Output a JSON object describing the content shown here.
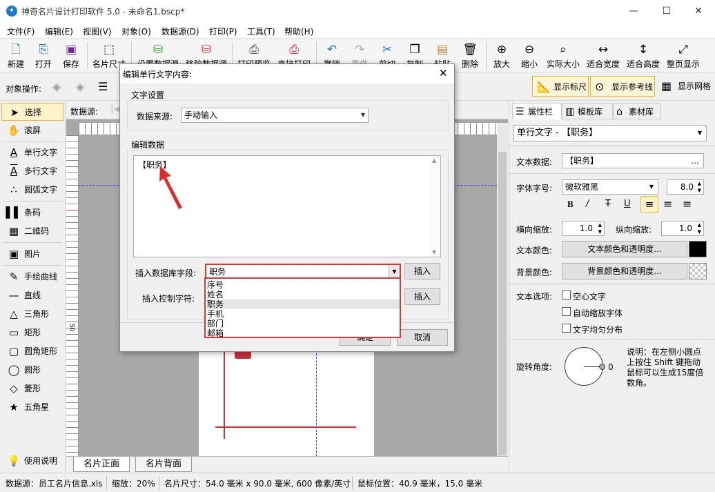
{
  "window": {
    "title": "神奇名片设计打印软件 5.0 - 未命名1.bscp*",
    "app_icon": "app-logo-icon"
  },
  "menu": [
    "文件(F)",
    "编辑(E)",
    "视图(V)",
    "对象(O)",
    "数据源(D)",
    "打印(P)",
    "工具(T)",
    "帮助(H)"
  ],
  "toolbar": [
    {
      "label": "新建",
      "icon": "new-file-icon",
      "glyph": "🗋"
    },
    {
      "label": "打开",
      "icon": "open-icon",
      "glyph": "📂"
    },
    {
      "label": "保存",
      "icon": "save-icon",
      "glyph": "💾"
    },
    {
      "label": "名片尺寸",
      "icon": "card-size-icon",
      "glyph": "⬚"
    },
    {
      "label": "设置数据源",
      "icon": "database-settings-icon",
      "glyph": "⛁"
    },
    {
      "label": "移除数据源",
      "icon": "database-remove-icon",
      "glyph": "⛁"
    },
    {
      "label": "打印预览",
      "icon": "print-preview-icon",
      "glyph": "🖶"
    },
    {
      "label": "直接打印",
      "icon": "print-icon",
      "glyph": "🖶"
    },
    {
      "label": "撤销",
      "icon": "undo-icon",
      "glyph": "↶"
    },
    {
      "label": "重做",
      "icon": "redo-icon",
      "glyph": "↷"
    },
    {
      "label": "剪切",
      "icon": "cut-icon",
      "glyph": "✂"
    },
    {
      "label": "复制",
      "icon": "copy-icon",
      "glyph": "⎘"
    },
    {
      "label": "粘贴",
      "icon": "paste-icon",
      "glyph": "📋"
    },
    {
      "label": "删除",
      "icon": "delete-icon",
      "glyph": "🗑"
    },
    {
      "label": "放大",
      "icon": "zoom-in-icon",
      "glyph": "⊕"
    },
    {
      "label": "缩小",
      "icon": "zoom-out-icon",
      "glyph": "⊖"
    },
    {
      "label": "实际大小",
      "icon": "actual-size-icon",
      "glyph": "⌕"
    },
    {
      "label": "适合宽度",
      "icon": "fit-width-icon",
      "glyph": "↔"
    },
    {
      "label": "适合高度",
      "icon": "fit-height-icon",
      "glyph": "↕"
    },
    {
      "label": "整页显示",
      "icon": "fit-page-icon",
      "glyph": "⤢"
    }
  ],
  "objbar": {
    "label": "对象操作:",
    "show_ruler": "显示标尺",
    "show_guides": "显示参考线",
    "show_grid": "显示网格"
  },
  "tools": [
    {
      "label": "选择",
      "icon": "pointer-icon",
      "glyph": "➤"
    },
    {
      "label": "滚屏",
      "icon": "hand-icon",
      "glyph": "✋"
    },
    {
      "label": "单行文字",
      "icon": "single-line-text-icon",
      "glyph": "A"
    },
    {
      "label": "多行文字",
      "icon": "multi-line-text-icon",
      "glyph": "A"
    },
    {
      "label": "圆弧文字",
      "icon": "arc-text-icon",
      "glyph": "∴"
    },
    {
      "label": "条码",
      "icon": "barcode-icon",
      "glyph": "▌"
    },
    {
      "label": "二维码",
      "icon": "qrcode-icon",
      "glyph": "▦"
    },
    {
      "label": "图片",
      "icon": "image-icon",
      "glyph": "▣"
    },
    {
      "label": "手绘曲线",
      "icon": "pen-icon",
      "glyph": "✎"
    },
    {
      "label": "直线",
      "icon": "line-icon",
      "glyph": "—"
    },
    {
      "label": "三角形",
      "icon": "triangle-icon",
      "glyph": "△"
    },
    {
      "label": "矩形",
      "icon": "rectangle-icon",
      "glyph": "▭"
    },
    {
      "label": "圆角矩形",
      "icon": "rounded-rect-icon",
      "glyph": "▢"
    },
    {
      "label": "圆形",
      "icon": "circle-icon",
      "glyph": "◯"
    },
    {
      "label": "菱形",
      "icon": "diamond-icon",
      "glyph": "◇"
    },
    {
      "label": "五角星",
      "icon": "star-icon",
      "glyph": "★"
    }
  ],
  "help_label": "使用说明",
  "canvas": {
    "datasource_label": "数据源:",
    "ruler_left_label": "50",
    "tabs": [
      "名片正面",
      "名片背面"
    ]
  },
  "right": {
    "tabs": [
      "属性栏",
      "模板库",
      "素材库"
    ],
    "object_select": "单行文字 - 【职务】",
    "text_data_label": "文本数据:",
    "text_data_value": "【职务】",
    "font_label": "字体字号:",
    "font_value": "微软雅黑",
    "font_size": "8.0",
    "hscale_label": "横向缩放:",
    "hscale": "1.0",
    "vscale_label": "纵向缩放:",
    "vscale": "1.0",
    "text_color_label": "文本颜色:",
    "text_color_btn": "文本颜色和透明度...",
    "bg_color_label": "背景颜色:",
    "bg_color_btn": "背景颜色和透明度...",
    "text_options_label": "文本选项:",
    "opt_hollow": "空心文字",
    "opt_autoscale": "自动缩放字体",
    "opt_distribute": "文字均匀分布",
    "rotate_label": "旋转角度:",
    "rotate_value": "0",
    "rotate_note": "说明：在左侧小圆点上按住 Shift 键拖动鼠标可以生成15度倍数角。",
    "text_color": "#000000"
  },
  "status": {
    "datasource": "数据源：员工名片信息.xls",
    "zoom": "缩放：20%",
    "card_size": "名片尺寸：54.0 毫米 x 90.0 毫米, 600 像素/英寸",
    "mouse_pos": "鼠标位置：40.9 毫米，15.0 毫米"
  },
  "dialog": {
    "title": "编辑单行文字内容:",
    "text_settings": "文字设置",
    "source_label": "数据来源:",
    "source_value": "手动输入",
    "edit_data": "编辑数据",
    "text_value": "【职务】",
    "insert_field_label": "插入数据库字段:",
    "insert_field_value": "职务",
    "insert_btn": "插入",
    "insert_ctrl_label": "插入控制字符:",
    "insert_btn2": "插入",
    "ok_btn": "确定",
    "cancel_btn": "取消",
    "dropdown_options": [
      "序号",
      "姓名",
      "职务",
      "手机",
      "部门",
      "邮箱"
    ]
  },
  "colors": {
    "accent_red": "#d8343b",
    "guide_blue": "#3344cc"
  }
}
